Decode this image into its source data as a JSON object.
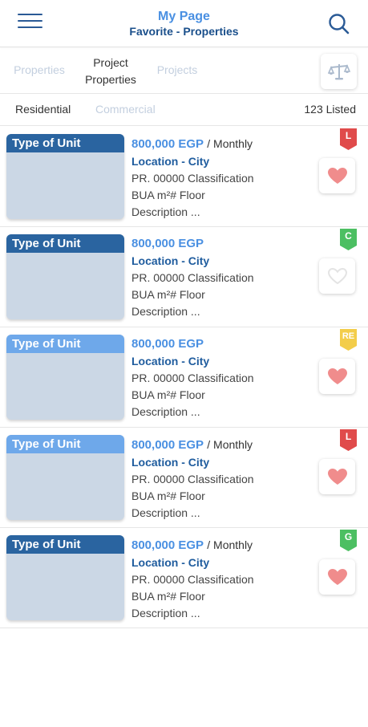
{
  "header": {
    "title": "My Page",
    "subtitle": "Favorite - Properties",
    "menu_icon": "hamburger-menu-icon",
    "search_icon": "search-icon"
  },
  "tabs": [
    {
      "label": "Properties",
      "active": false
    },
    {
      "label": "Project\nProperties",
      "active": true
    },
    {
      "label": "Projects",
      "active": false
    }
  ],
  "compare_icon": "scale-balance-icon",
  "filters": {
    "residential": "Residential",
    "commercial": "Commercial",
    "count": "123 Listed"
  },
  "colors": {
    "accent": "#4a90e2",
    "navy": "#1f5c9e",
    "heart": "#f08c8c",
    "badge_red": "#e04b4b",
    "badge_green": "#4cbf62",
    "badge_yellow": "#f3cd4a"
  },
  "listings": [
    {
      "type": "Type of Unit",
      "price": "800,000 EGP",
      "period": "/ Monthly",
      "location": "Location - City",
      "classification": "PR. 00000 Classification",
      "bua": "BUA m²# Floor",
      "description": "Description ...",
      "badge": "L",
      "badge_color": "#e04b4b",
      "favorited": true,
      "label_style": "dark"
    },
    {
      "type": "Type of Unit",
      "price": "800,000 EGP",
      "period": "",
      "location": "Location - City",
      "classification": "PR. 00000 Classification",
      "bua": "BUA m²# Floor",
      "description": "Description ...",
      "badge": "C",
      "badge_color": "#4cbf62",
      "favorited": false,
      "label_style": "dark"
    },
    {
      "type": "Type of Unit",
      "price": "800,000 EGP",
      "period": "",
      "location": "Location - City",
      "classification": "PR. 00000 Classification",
      "bua": "BUA m²# Floor",
      "description": "Description ...",
      "badge": "RE",
      "badge_color": "#f3cd4a",
      "favorited": true,
      "label_style": "light"
    },
    {
      "type": "Type of Unit",
      "price": "800,000 EGP",
      "period": "/ Monthly",
      "location": "Location - City",
      "classification": "PR. 00000 Classification",
      "bua": "BUA m²# Floor",
      "description": "Description ...",
      "badge": "L",
      "badge_color": "#e04b4b",
      "favorited": true,
      "label_style": "light"
    },
    {
      "type": "Type of Unit",
      "price": "800,000 EGP",
      "period": "/ Monthly",
      "location": "Location - City",
      "classification": "PR. 00000 Classification",
      "bua": "BUA m²# Floor",
      "description": "Description ...",
      "badge": "G",
      "badge_color": "#4cbf62",
      "favorited": true,
      "label_style": "dark"
    }
  ]
}
